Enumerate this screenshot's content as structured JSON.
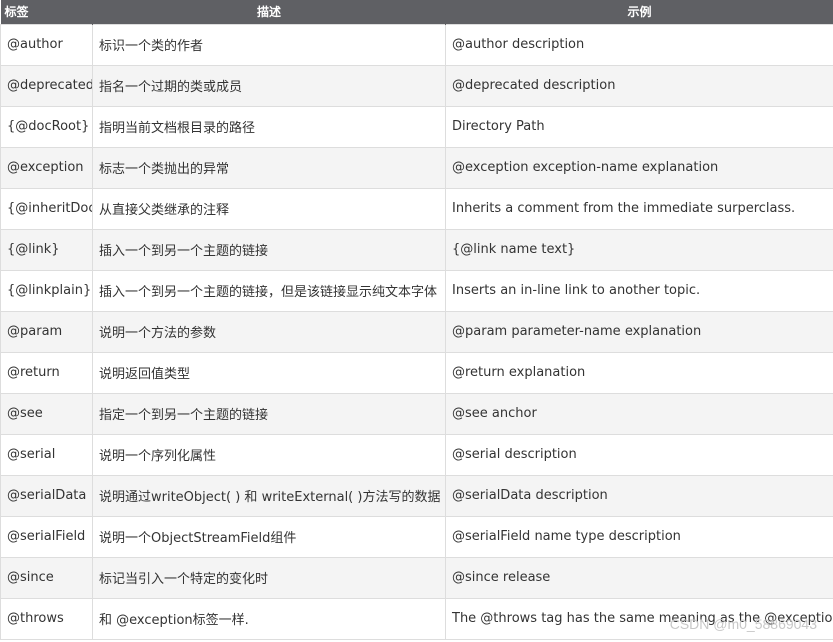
{
  "table": {
    "headers": [
      "标签",
      "描述",
      "示例"
    ],
    "rows": [
      {
        "tag": "@author",
        "desc": "标识一个类的作者",
        "example": "@author description"
      },
      {
        "tag": "@deprecated",
        "desc": "指名一个过期的类或成员",
        "example": "@deprecated description"
      },
      {
        "tag": "{@docRoot}",
        "desc": "指明当前文档根目录的路径",
        "example": "Directory Path"
      },
      {
        "tag": "@exception",
        "desc": "标志一个类抛出的异常",
        "example": "@exception exception-name explanation"
      },
      {
        "tag": "{@inheritDoc}",
        "desc": "从直接父类继承的注释",
        "example": "Inherits a comment from the immediate surperclass."
      },
      {
        "tag": "{@link}",
        "desc": "插入一个到另一个主题的链接",
        "example": "{@link name text}"
      },
      {
        "tag": "{@linkplain}",
        "desc": "插入一个到另一个主题的链接，但是该链接显示纯文本字体",
        "example": "Inserts an in-line link to another topic."
      },
      {
        "tag": "@param",
        "desc": "说明一个方法的参数",
        "example": "@param parameter-name explanation"
      },
      {
        "tag": "@return",
        "desc": "说明返回值类型",
        "example": "@return explanation"
      },
      {
        "tag": "@see",
        "desc": "指定一个到另一个主题的链接",
        "example": "@see anchor"
      },
      {
        "tag": "@serial",
        "desc": "说明一个序列化属性",
        "example": "@serial description"
      },
      {
        "tag": "@serialData",
        "desc": "说明通过writeObject( ) 和 writeExternal( )方法写的数据",
        "example": "@serialData description"
      },
      {
        "tag": "@serialField",
        "desc": "说明一个ObjectStreamField组件",
        "example": "@serialField name type description"
      },
      {
        "tag": "@since",
        "desc": "标记当引入一个特定的变化时",
        "example": "@since release"
      },
      {
        "tag": "@throws",
        "desc": "和 @exception标签一样.",
        "example": "The @throws tag has the same meaning as the @exception tag."
      }
    ]
  },
  "watermark": "CSDN @m0_58869043"
}
